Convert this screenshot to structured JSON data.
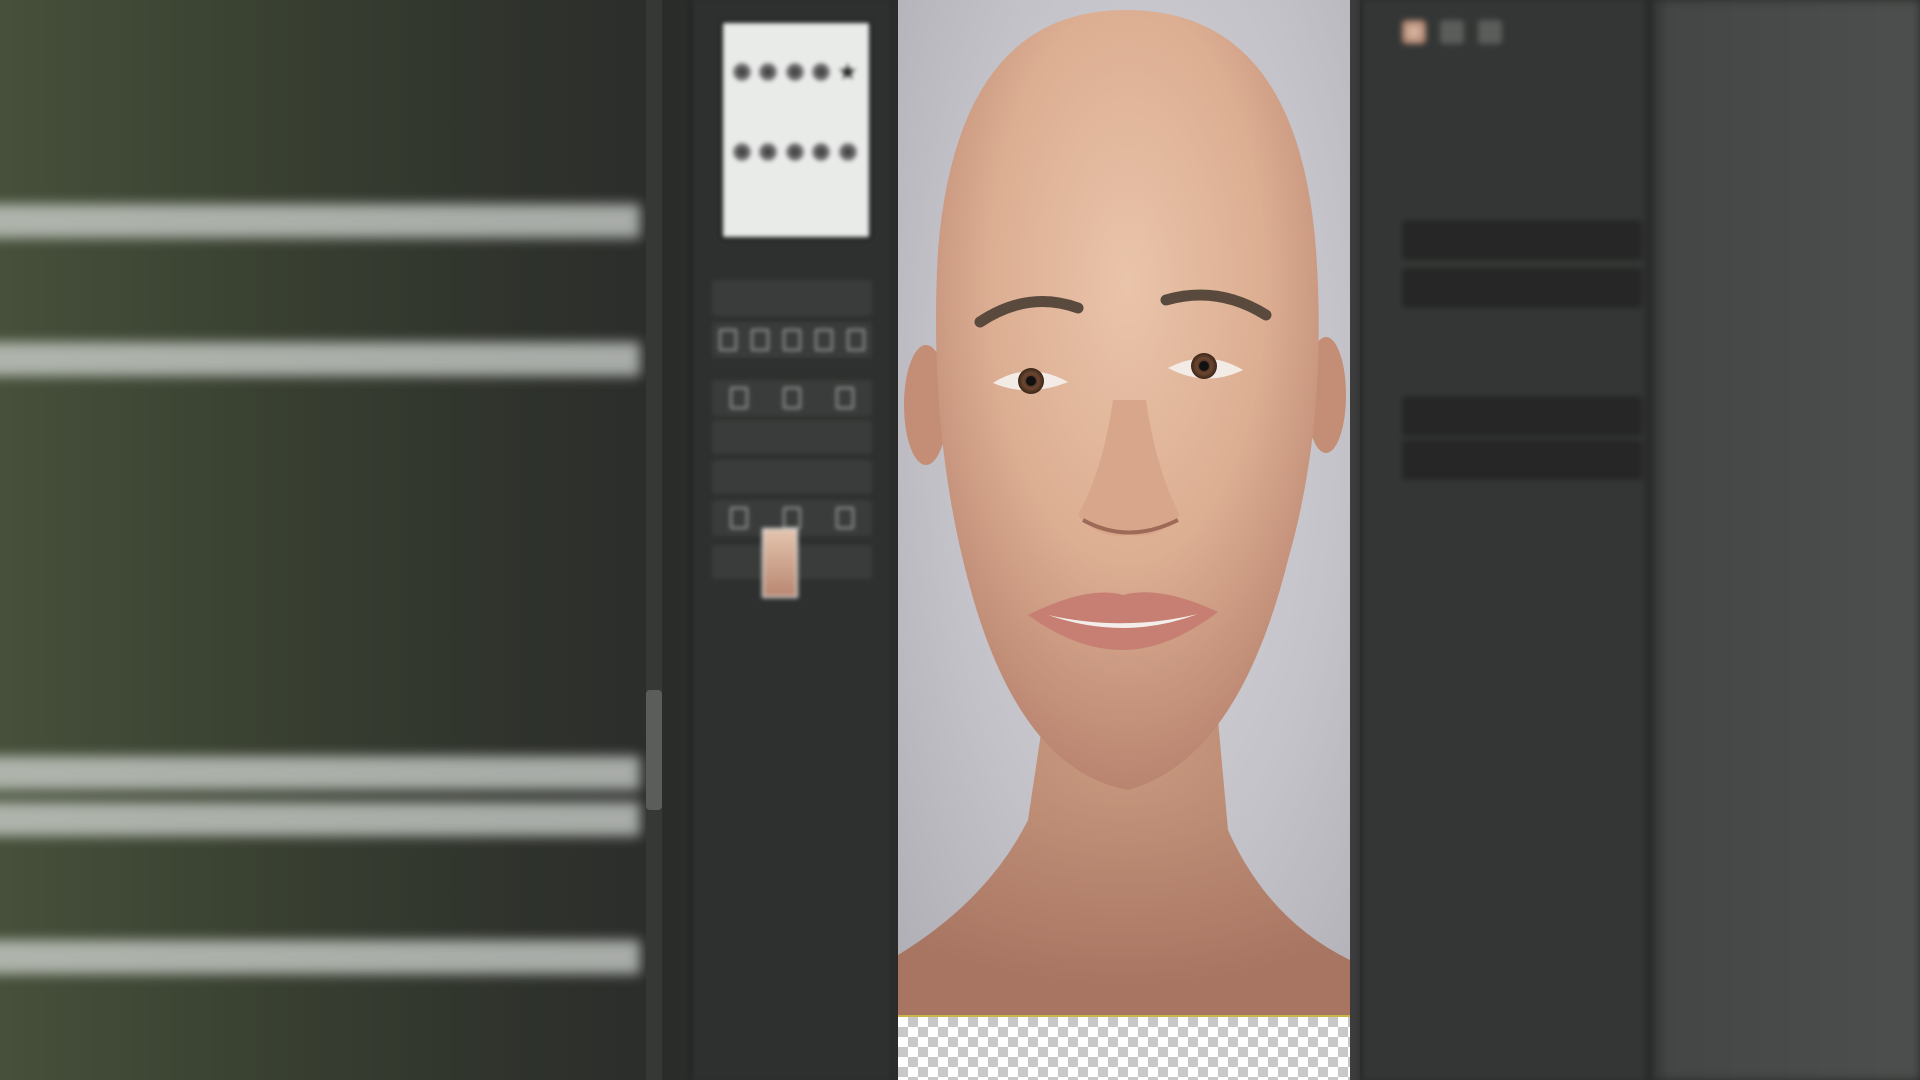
{
  "outliner": {
    "rows": [
      {
        "text": "",
        "highlight": false
      },
      {
        "text": "",
        "highlight": false
      },
      {
        "text": "",
        "highlight": false
      },
      {
        "text": "",
        "highlight": false
      },
      {
        "text": "",
        "highlight": true
      },
      {
        "text": "",
        "highlight": false
      },
      {
        "text": "",
        "highlight": false
      },
      {
        "text": "",
        "highlight": true
      },
      {
        "text": "",
        "highlight": false
      },
      {
        "text": "",
        "highlight": false
      },
      {
        "text": "",
        "highlight": false
      },
      {
        "text": "",
        "highlight": false
      },
      {
        "text": "",
        "highlight": false
      },
      {
        "text": "",
        "highlight": false
      },
      {
        "text": "",
        "highlight": false
      },
      {
        "text": "",
        "highlight": false
      },
      {
        "text": "",
        "highlight": true
      },
      {
        "text": "",
        "highlight": true
      },
      {
        "text": "",
        "highlight": false
      },
      {
        "text": "",
        "highlight": false
      },
      {
        "text": "",
        "highlight": true
      },
      {
        "text": "",
        "highlight": false
      },
      {
        "text": "",
        "highlight": false
      }
    ]
  },
  "palette": {
    "preview_label": "",
    "fields": [
      "",
      "",
      ""
    ],
    "icons": [
      "brush-icon",
      "eraser-icon",
      "smudge-icon",
      "lock-icon",
      "layers-icon"
    ]
  },
  "viewport": {
    "subject": "3D head render",
    "background_color": "#c9c8ce",
    "skin_color": "#e2b79d"
  },
  "properties": {
    "rows": [
      {
        "label": "",
        "value": "",
        "field": false
      },
      {
        "label": "",
        "value": "",
        "field": false
      },
      {
        "label": "",
        "value": "",
        "field": true
      },
      {
        "label": "",
        "value": "",
        "field": true
      },
      {
        "label": "",
        "value": "",
        "field": false
      },
      {
        "label": "",
        "value": "",
        "field": false
      },
      {
        "label": "",
        "value": "",
        "field": true
      },
      {
        "label": "",
        "value": "",
        "field": true
      },
      {
        "label": "",
        "value": "",
        "field": false
      },
      {
        "label": "",
        "value": "",
        "field": false
      },
      {
        "label": "",
        "value": "",
        "field": false
      },
      {
        "label": "",
        "value": "",
        "field": false
      }
    ]
  },
  "far_right": {
    "labels": [
      "",
      "",
      "",
      "",
      ""
    ]
  }
}
